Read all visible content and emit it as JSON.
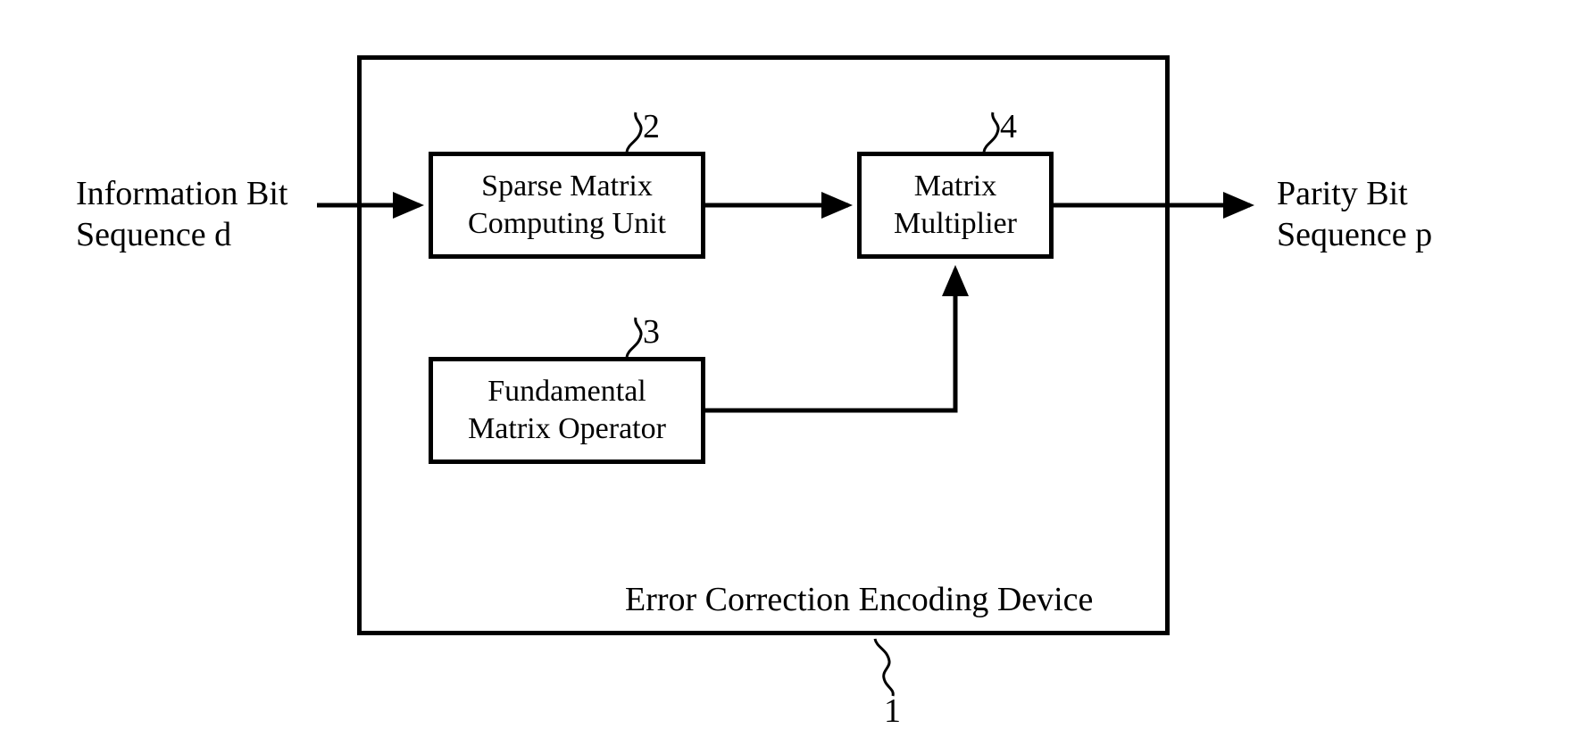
{
  "chart_data": {
    "type": "block-diagram",
    "title": "Error Correction Encoding Device",
    "input": {
      "label": "Information Bit Sequence d"
    },
    "output": {
      "label": "Parity Bit Sequence p"
    },
    "device": {
      "label": "Error Correction Encoding Device",
      "ref": "1"
    },
    "blocks": [
      {
        "id": 2,
        "ref": "2",
        "label": "Sparse Matrix Computing Unit"
      },
      {
        "id": 3,
        "ref": "3",
        "label": "Fundamental Matrix Operator"
      },
      {
        "id": 4,
        "ref": "4",
        "label": "Matrix Multiplier"
      }
    ],
    "flows": [
      {
        "from": "input",
        "to": 2
      },
      {
        "from": 2,
        "to": 4
      },
      {
        "from": 3,
        "to": 4
      },
      {
        "from": 4,
        "to": "output"
      }
    ]
  },
  "input_label_l1": "Information Bit",
  "input_label_l2": "Sequence d",
  "output_label_l1": "Parity Bit",
  "output_label_l2": "Sequence p",
  "device_label": "Error Correction Encoding Device",
  "block2_l1": "Sparse Matrix",
  "block2_l2": "Computing Unit",
  "block3_l1": "Fundamental",
  "block3_l2": "Matrix Operator",
  "block4_l1": "Matrix",
  "block4_l2": "Multiplier",
  "ref1": "1",
  "ref2": "2",
  "ref3": "3",
  "ref4": "4"
}
